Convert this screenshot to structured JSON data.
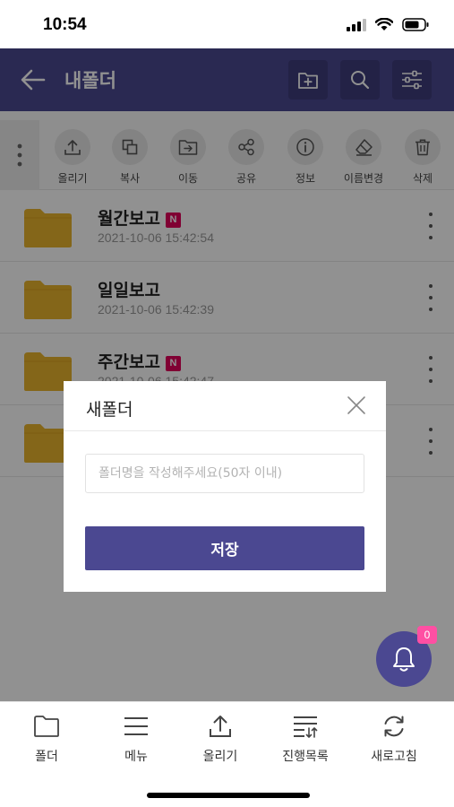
{
  "status_bar": {
    "time": "10:54"
  },
  "header": {
    "title": "내폴더",
    "actions": [
      "new-folder-icon",
      "search-icon",
      "filter-settings-icon"
    ]
  },
  "toolbar": {
    "items": [
      {
        "label": "올리기",
        "icon": "upload-icon"
      },
      {
        "label": "복사",
        "icon": "copy-icon"
      },
      {
        "label": "이동",
        "icon": "move-icon"
      },
      {
        "label": "공유",
        "icon": "share-icon"
      },
      {
        "label": "정보",
        "icon": "info-icon"
      },
      {
        "label": "이름변경",
        "icon": "rename-icon"
      },
      {
        "label": "삭제",
        "icon": "trash-icon"
      }
    ]
  },
  "folders": [
    {
      "name": "월간보고",
      "date": "2021-10-06 15:42:54",
      "badge": "N"
    },
    {
      "name": "일일보고",
      "date": "2021-10-06 15:42:39",
      "badge": ""
    },
    {
      "name": "주간보고",
      "date": "2021-10-06 15:42:47",
      "badge": "N"
    },
    {
      "name": "",
      "date": "",
      "badge": ""
    }
  ],
  "fab": {
    "icon": "bell-icon",
    "badge_count": "0"
  },
  "dialog": {
    "title": "새폴더",
    "input_placeholder": "폴더명을 작성해주세요(50자 이내)",
    "input_value": "",
    "save_label": "저장"
  },
  "bottom_nav": {
    "items": [
      {
        "label": "폴더",
        "icon": "folder-icon"
      },
      {
        "label": "메뉴",
        "icon": "menu-icon"
      },
      {
        "label": "올리기",
        "icon": "upload-icon"
      },
      {
        "label": "진행목록",
        "icon": "progress-list-icon"
      },
      {
        "label": "새로고침",
        "icon": "refresh-icon"
      }
    ]
  },
  "colors": {
    "primary": "#4b4891",
    "folder": "#e8b32c",
    "badge_new": "#e2005a",
    "fab_badge": "#ff4fa3"
  }
}
